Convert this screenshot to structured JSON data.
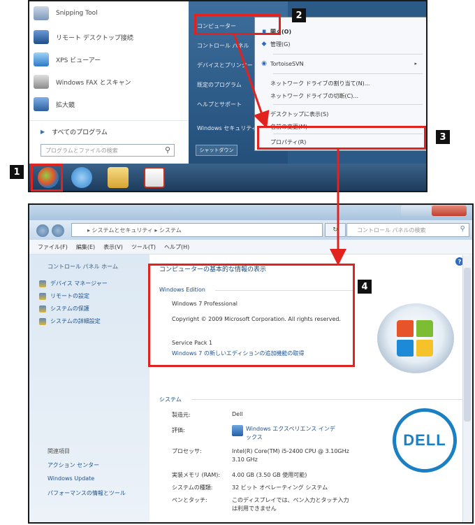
{
  "start_menu": {
    "programs": [
      {
        "label": "Snipping Tool",
        "icon": "snipping-tool-icon"
      },
      {
        "label": "リモート デスクトップ接続",
        "icon": "remote-desktop-icon"
      },
      {
        "label": "XPS ビューアー",
        "icon": "xps-viewer-icon"
      },
      {
        "label": "Windows FAX とスキャン",
        "icon": "fax-scan-icon"
      },
      {
        "label": "拡大鏡",
        "icon": "magnifier-icon"
      }
    ],
    "all_programs": "すべてのプログラム",
    "search_placeholder": "プログラムとファイルの検索",
    "right_items": [
      "コンピューター",
      "コントロール パネル",
      "デバイスとプリンター",
      "既定のプログラム",
      "ヘルプとサポート",
      "Windows セキュリティ"
    ],
    "shutdown": "シャットダウン"
  },
  "context_menu": {
    "items": [
      "開く(O)",
      "管理(G)",
      "TortoiseSVN",
      "ネットワーク ドライブの割り当て(N)...",
      "ネットワーク ドライブの切断(C)...",
      "デスクトップに表示(S)",
      "名前の変更(M)",
      "プロパティ(R)"
    ],
    "submenu_arrow": "▸"
  },
  "control_panel": {
    "breadcrumb": "▸ システムとセキュリティ ▸ システム",
    "search_placeholder": "コントロール パネルの検索",
    "menus": [
      "ファイル(F)",
      "編集(E)",
      "表示(V)",
      "ツール(T)",
      "ヘルプ(H)"
    ],
    "sidebar": {
      "home": "コントロール パネル ホーム",
      "links": [
        "デバイス マネージャー",
        "リモートの設定",
        "システムの保護",
        "システムの詳細設定"
      ],
      "see_also": "関連項目",
      "see_also_links": [
        "アクション センター",
        "Windows Update",
        "パフォーマンスの情報とツール"
      ]
    },
    "main": {
      "heading": "コンピューターの基本的な情報の表示",
      "edition_title": "Windows Edition",
      "edition": "Windows 7 Professional",
      "copyright": "Copyright © 2009 Microsoft Corporation.  All rights reserved.",
      "service_pack": "Service Pack 1",
      "upgrade_link": "Windows 7 の新しいエディションの追加機能の取得",
      "system_title": "システム",
      "rows": [
        {
          "label": "製造元:",
          "value": "Dell"
        },
        {
          "label": "評価:",
          "value": "Windows エクスペリエンス インデックス"
        },
        {
          "label": "プロセッサ:",
          "value": "Intel(R) Core(TM) i5-2400 CPU @ 3.10GHz   3.10 GHz"
        },
        {
          "label": "実装メモリ (RAM):",
          "value": "4.00 GB (3.50 GB 使用可能)"
        },
        {
          "label": "システムの種類:",
          "value": "32 ビット オペレーティング システム"
        },
        {
          "label": "ペンとタッチ:",
          "value": "このディスプレイでは、ペン入力とタッチ入力は利用できません"
        }
      ],
      "dell_logo": "DELL"
    }
  },
  "steps": [
    "1",
    "2",
    "3",
    "4"
  ],
  "colors": {
    "highlight": "#e2221f",
    "badge": "#111111",
    "taskbar": "#1d3c5d"
  }
}
